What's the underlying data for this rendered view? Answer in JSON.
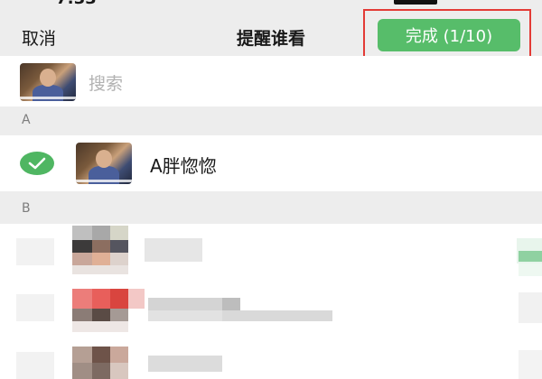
{
  "topbar": {
    "cancel_label": "取消",
    "title": "提醒谁看",
    "done_label": "完成 (1/10)"
  },
  "search": {
    "placeholder": "搜索"
  },
  "sections": [
    {
      "letter": "A"
    },
    {
      "letter": "B"
    }
  ],
  "contacts": [
    {
      "name": "A胖惚惚",
      "selected": true
    }
  ],
  "colors": {
    "accent_green": "#57bd6a",
    "highlight_red": "#e33b36",
    "background": "#ededed"
  }
}
